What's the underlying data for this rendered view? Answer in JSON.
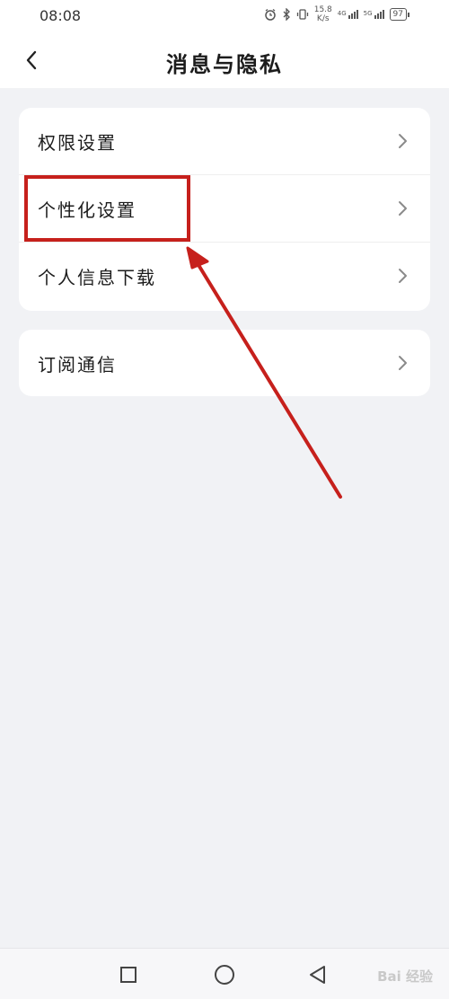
{
  "status_bar": {
    "time": "08:08",
    "net_speed_value": "15.8",
    "net_speed_unit": "K/s",
    "network_tag_1": "4G",
    "network_tag_2": "5G",
    "battery": "97"
  },
  "header": {
    "title": "消息与隐私"
  },
  "settings": {
    "group_1": [
      {
        "label": "权限设置"
      },
      {
        "label": "个性化设置"
      },
      {
        "label": "个人信息下载"
      }
    ],
    "group_2": [
      {
        "label": "订阅通信"
      }
    ]
  },
  "annotation": {
    "color": "#c6201c",
    "highlighted_item": "个性化设置"
  },
  "nav_bar": {
    "watermark": "Bai 经验"
  },
  "icons": {
    "back": "chevron-left-icon",
    "row_arrow": "chevron-right-icon",
    "recents": "square-icon",
    "home": "circle-icon",
    "nav_back": "triangle-left-icon"
  }
}
